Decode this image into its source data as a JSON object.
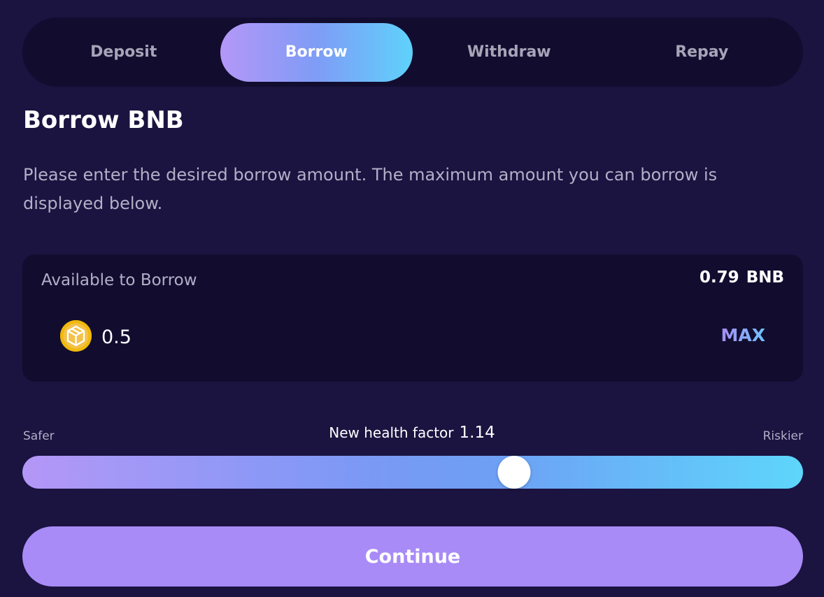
{
  "tabs": [
    {
      "label": "Deposit",
      "active": false
    },
    {
      "label": "Borrow",
      "active": true
    },
    {
      "label": "Withdraw",
      "active": false
    },
    {
      "label": "Repay",
      "active": false
    }
  ],
  "title": "Borrow BNB",
  "description": "Please enter the desired borrow amount. The maximum amount you can borrow is displayed below.",
  "card": {
    "available_label": "Available to Borrow",
    "available_amount": "0.79",
    "available_unit": "BNB",
    "token_icon": "bnb-icon",
    "amount_value": "0.5",
    "max_label": "MAX"
  },
  "health": {
    "safer_label": "Safer",
    "riskier_label": "Riskier",
    "label": "New health factor",
    "value": "1.14",
    "slider_fraction": 0.63
  },
  "continue_label": "Continue",
  "colors": {
    "background": "#1b1340",
    "panel": "#120d2f",
    "accent_purple": "#a88bf6",
    "accent_cyan": "#5fd2fb",
    "bnb_yellow": "#f0b90b"
  }
}
